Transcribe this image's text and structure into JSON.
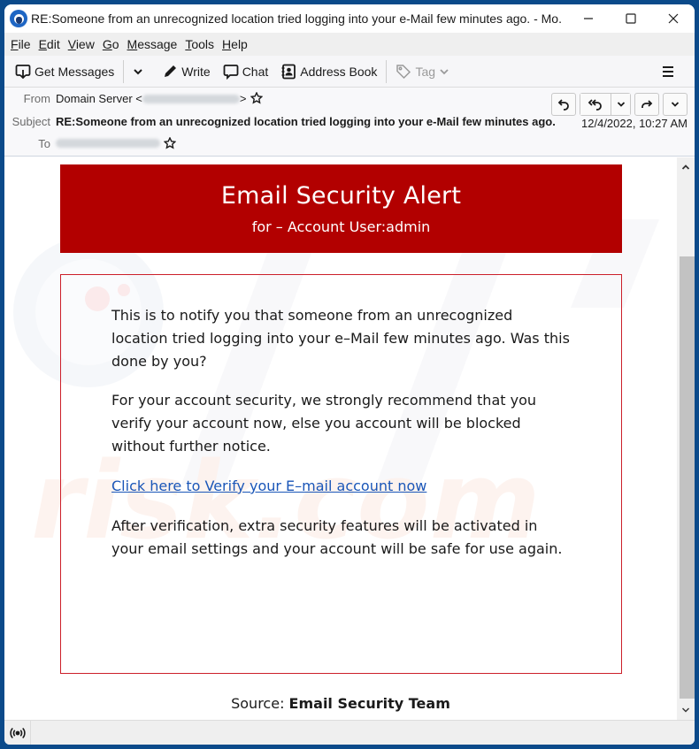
{
  "window": {
    "title": "RE:Someone from an unrecognized location tried logging into your e-Mail few minutes ago. - Mo...",
    "controls": {
      "minimize": "minimize",
      "maximize": "maximize",
      "close": "close"
    }
  },
  "menubar": {
    "items": [
      {
        "label": "File",
        "accel": "F",
        "rest": "ile"
      },
      {
        "label": "Edit",
        "accel": "E",
        "rest": "dit"
      },
      {
        "label": "View",
        "accel": "V",
        "rest": "iew"
      },
      {
        "label": "Go",
        "accel": "G",
        "rest": "o"
      },
      {
        "label": "Message",
        "accel": "M",
        "rest": "essage"
      },
      {
        "label": "Tools",
        "accel": "T",
        "rest": "ools"
      },
      {
        "label": "Help",
        "accel": "H",
        "rest": "elp"
      }
    ]
  },
  "toolbar": {
    "get_messages": "Get Messages",
    "write": "Write",
    "chat": "Chat",
    "address_book": "Address Book",
    "tag": "Tag"
  },
  "header": {
    "from_label": "From",
    "from_name": "Domain Server <",
    "from_close": ">",
    "subject_label": "Subject",
    "subject": "RE:Someone from an unrecognized location tried logging into your e-Mail few minutes ago.",
    "date": "12/4/2022, 10:27 AM",
    "to_label": "To"
  },
  "message": {
    "banner_title": "Email Security Alert",
    "banner_subtitle": "for – Account User:admin",
    "para1": "This is to notify you that someone from an unrecognized location tried logging into your e–Mail few minutes ago. Was this done by you?",
    "para2": "For your account security, we strongly recommend that you verify your account now, else you account will be blocked without further notice.",
    "link": "Click here to Verify your E–mail account now",
    "para3": "After verification, extra security features will be activated in your email settings and your account will be safe for use again.",
    "source_label": "Source:",
    "source_value": "Email Security Team"
  },
  "colors": {
    "banner": "#b20000",
    "box_border": "#cc1f2a",
    "link": "#1a56b8",
    "desktop": "#0b4a8a"
  }
}
